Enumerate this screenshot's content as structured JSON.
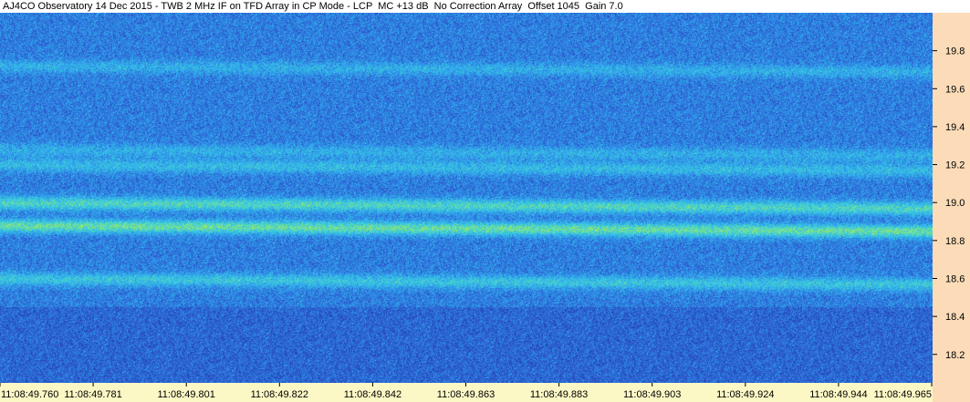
{
  "title": "AJ4CO Observatory 14 Dec 2015 - TWB 2 MHz IF on TFD Array in CP Mode - LCP  MC +13 dB  No Correction Array  Offset 1045  Gain 7.0",
  "colors": {
    "background_blue": "#2a52c0",
    "right_axis_bg": "#fcdcb8",
    "bottom_axis_bg": "#fcf8c6",
    "colormap": [
      "#1e3aa8",
      "#2f63d6",
      "#2fa8ef",
      "#3fd3d8",
      "#9ee860",
      "#e8ef3a"
    ]
  },
  "chart_data": {
    "type": "heatmap",
    "title": "AJ4CO Observatory 14 Dec 2015 - TWB 2 MHz IF on TFD Array in CP Mode - LCP  MC +13 dB  No Correction Array  Offset 1045  Gain 7.0",
    "xlabel": "",
    "ylabel": "",
    "x_ticks": [
      "11:08:49.760",
      "11:08:49.781",
      "11:08:49.801",
      "11:08:49.822",
      "11:08:49.842",
      "11:08:49.863",
      "11:08:49.883",
      "11:08:49.903",
      "11:08:49.924",
      "11:08:49.944",
      "11:08:49.965"
    ],
    "y_ticks": [
      19.8,
      19.6,
      19.4,
      19.2,
      19.0,
      18.8,
      18.6,
      18.4,
      18.2
    ],
    "ylim": [
      18.05,
      20.0
    ],
    "y_axis_side": "right",
    "emission_bands": [
      {
        "freq": 19.72,
        "intensity": 0.35
      },
      {
        "freq": 19.28,
        "intensity": 0.35
      },
      {
        "freq": 19.2,
        "intensity": 0.45
      },
      {
        "freq": 19.0,
        "intensity": 0.75
      },
      {
        "freq": 18.88,
        "intensity": 0.9
      },
      {
        "freq": 18.6,
        "intensity": 0.55
      }
    ]
  }
}
